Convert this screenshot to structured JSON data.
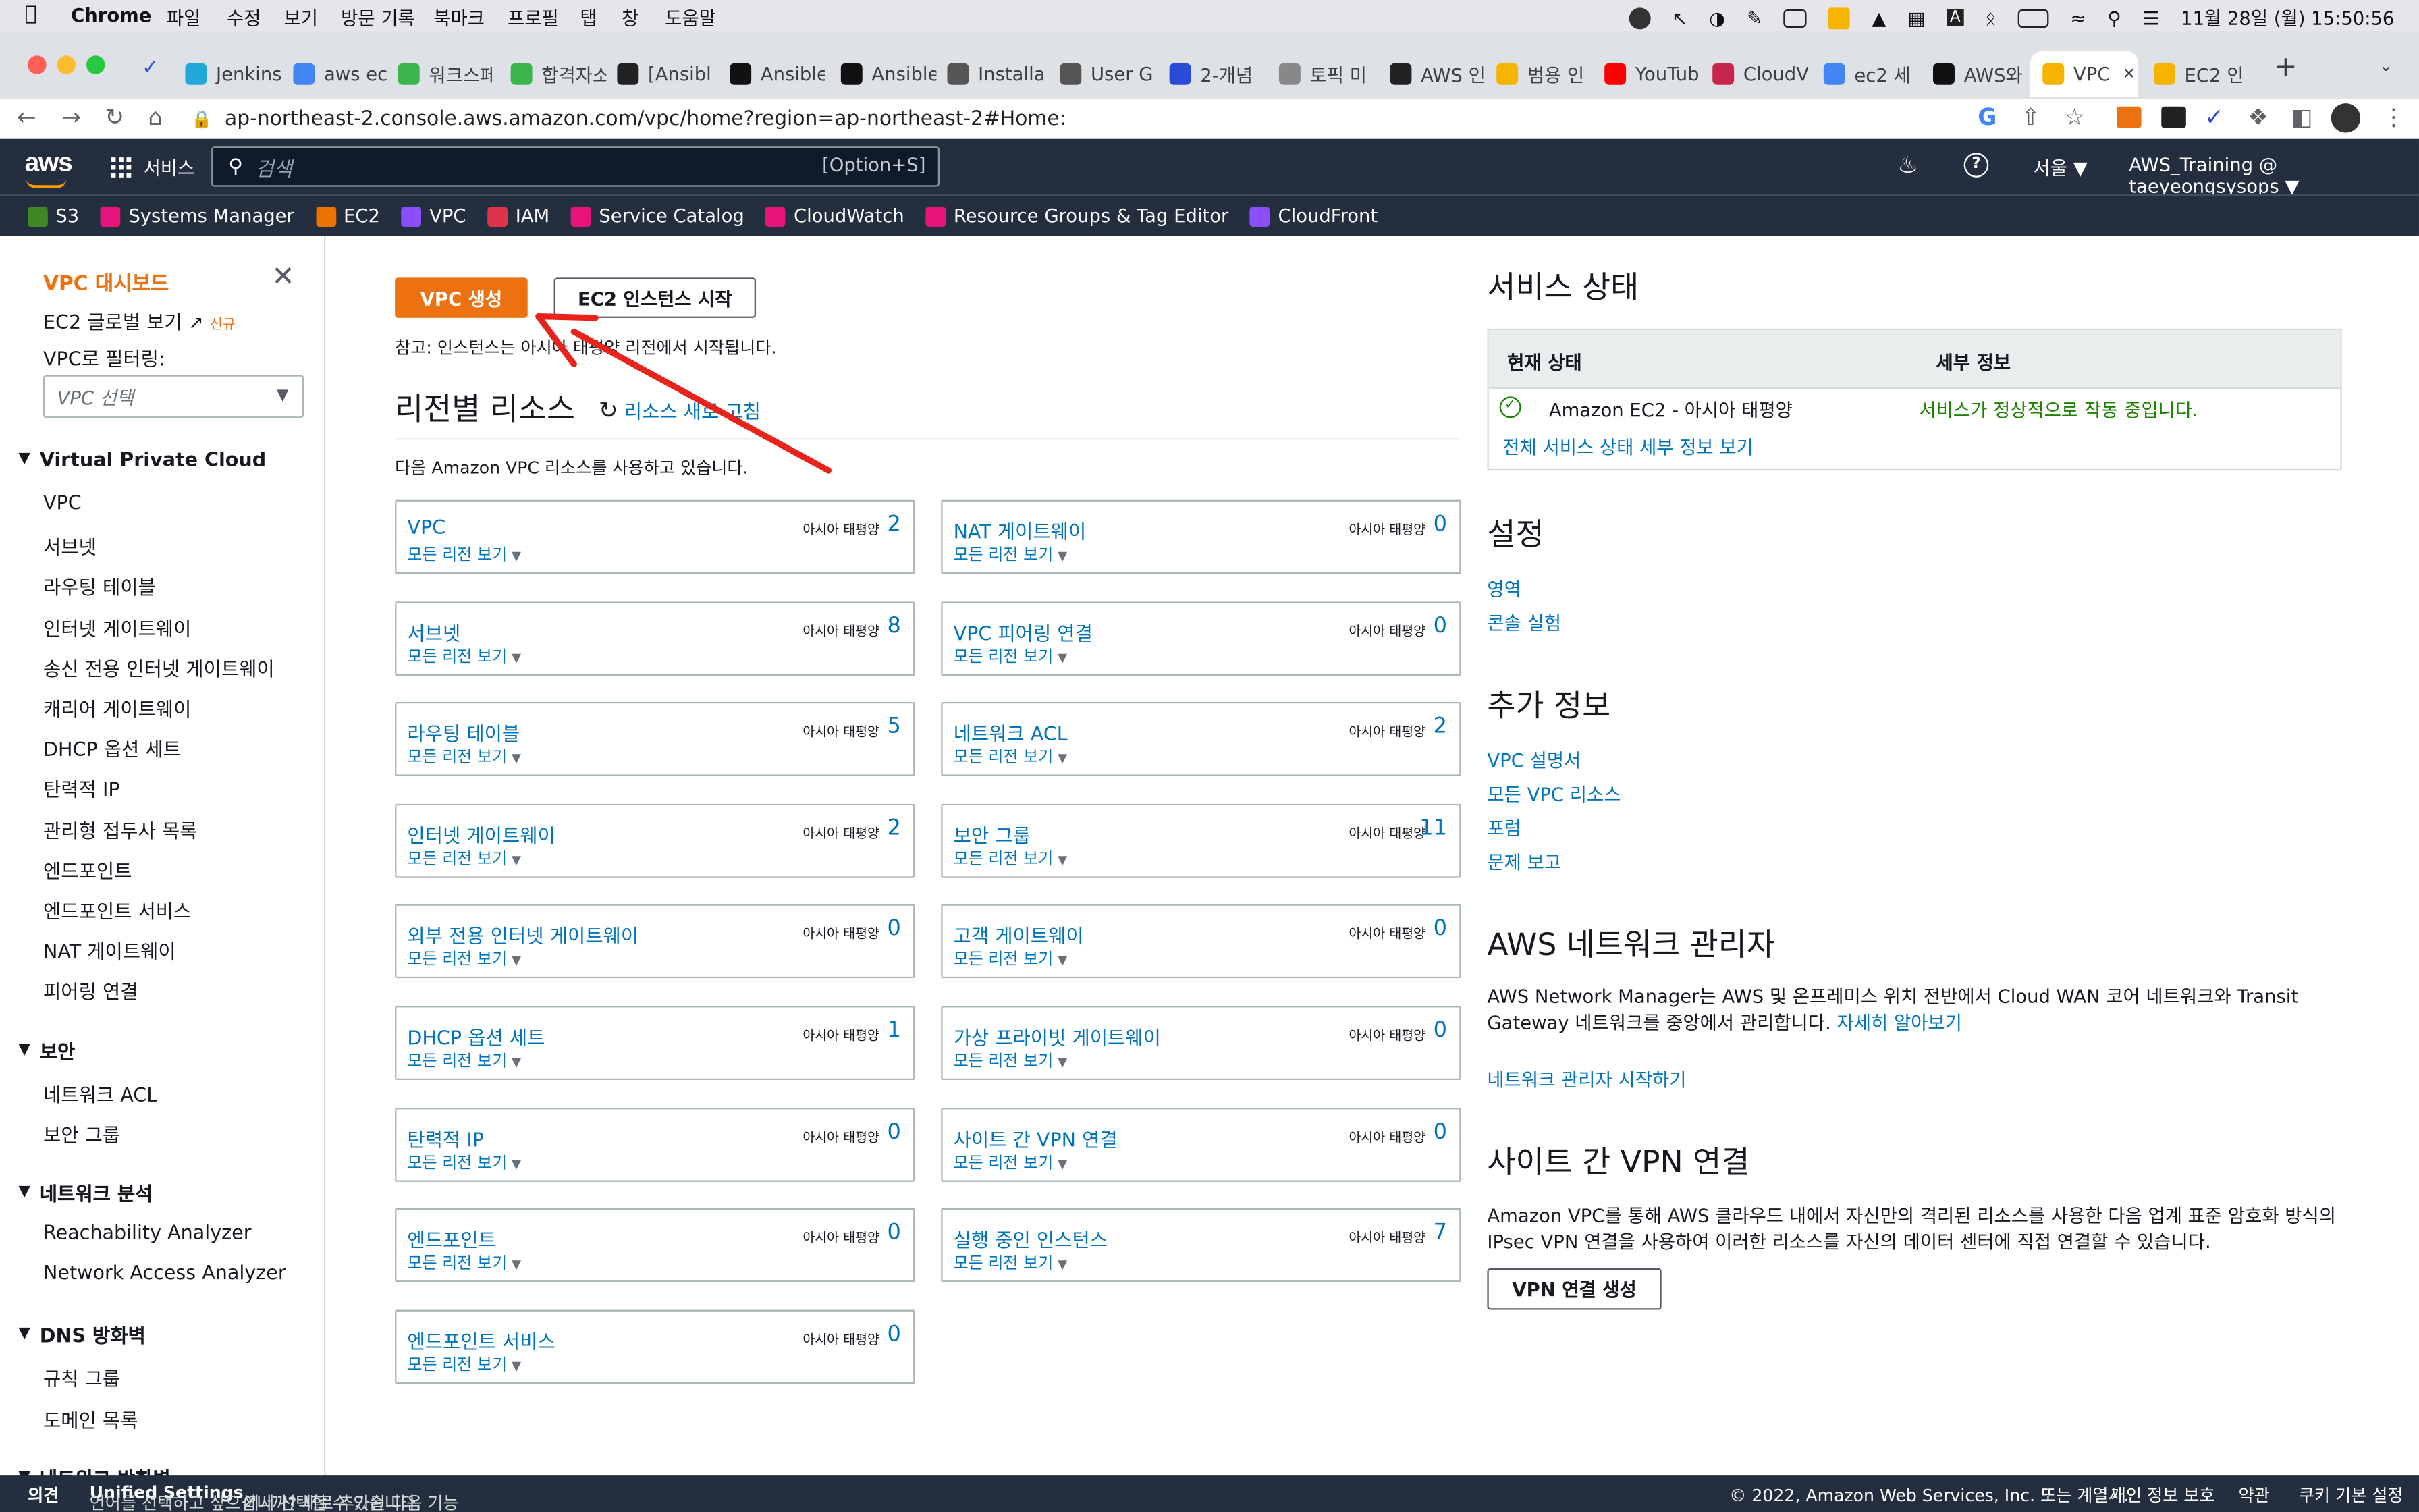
{
  "menubar": {
    "app": "Chrome",
    "items": [
      "파일",
      "수정",
      "보기",
      "방문 기록",
      "북마크",
      "프로필",
      "탭",
      "창",
      "도움말"
    ],
    "datetime": "11월 28일 (월)  15:50:56"
  },
  "tabs": [
    {
      "label": "Jenkins",
      "color": "#20a8d8"
    },
    {
      "label": "aws ec",
      "color": "#4285f4"
    },
    {
      "label": "워크스페",
      "color": "#3ab54a"
    },
    {
      "label": "합격자소",
      "color": "#3ab54a"
    },
    {
      "label": "[Ansibl",
      "color": "#222"
    },
    {
      "label": "Ansible",
      "color": "#111"
    },
    {
      "label": "Ansible",
      "color": "#111"
    },
    {
      "label": "Installa",
      "color": "#555"
    },
    {
      "label": "User G",
      "color": "#555"
    },
    {
      "label": "2-개념",
      "color": "#2a4bd7"
    },
    {
      "label": "토픽 미",
      "color": "#888"
    },
    {
      "label": "AWS 인",
      "color": "#222"
    },
    {
      "label": "범용 인",
      "color": "#f4b400"
    },
    {
      "label": "YouTub",
      "color": "#ff0000"
    },
    {
      "label": "CloudV",
      "color": "#c7254e"
    },
    {
      "label": "ec2 세",
      "color": "#4285f4"
    },
    {
      "label": "AWS와",
      "color": "#111"
    },
    {
      "label": "VPC",
      "color": "#f4b400"
    },
    {
      "label": "EC2 인",
      "color": "#f4b400"
    }
  ],
  "address": {
    "url": "ap-northeast-2.console.aws.amazon.com/vpc/home?region=ap-northeast-2#Home:"
  },
  "header": {
    "services": "서비스",
    "search_placeholder": "검색",
    "shortcut": "[Option+S]",
    "region": "서울 ▼",
    "account": "AWS_Training @ taeyeongsysops ▼"
  },
  "favorites": [
    {
      "label": "S3",
      "color": "#3f8624"
    },
    {
      "label": "Systems Manager",
      "color": "#e7157b"
    },
    {
      "label": "EC2",
      "color": "#ed7100"
    },
    {
      "label": "VPC",
      "color": "#8c4fff"
    },
    {
      "label": "IAM",
      "color": "#dd344c"
    },
    {
      "label": "Service Catalog",
      "color": "#e7157b"
    },
    {
      "label": "CloudWatch",
      "color": "#e7157b"
    },
    {
      "label": "Resource Groups & Tag Editor",
      "color": "#e7157b"
    },
    {
      "label": "CloudFront",
      "color": "#8c4fff"
    }
  ],
  "sidebar": {
    "title": "VPC 대시보드",
    "global_view": "EC2 글로벌 보기",
    "new_badge": "신규",
    "filter_label": "VPC로 필터링:",
    "filter_placeholder": "VPC 선택",
    "sections": [
      {
        "title": "Virtual Private Cloud",
        "items": [
          "VPC",
          "서브넷",
          "라우팅 테이블",
          "인터넷 게이트웨이",
          "송신 전용 인터넷 게이트웨이",
          "캐리어 게이트웨이",
          "DHCP 옵션 세트",
          "탄력적 IP",
          "관리형 접두사 목록",
          "엔드포인트",
          "엔드포인트 서비스",
          "NAT 게이트웨이",
          "피어링 연결"
        ]
      },
      {
        "title": "보안",
        "items": [
          "네트워크 ACL",
          "보안 그룹"
        ]
      },
      {
        "title": "네트워크 분석",
        "items": [
          "Reachability Analyzer",
          "Network Access Analyzer"
        ]
      },
      {
        "title": "DNS 방화벽",
        "items": [
          "규칙 그룹",
          "도메인 목록"
        ]
      },
      {
        "title": "네트워크 방화벽",
        "items": []
      }
    ]
  },
  "main": {
    "create_vpc": "VPC 생성",
    "launch_ec2": "EC2 인스턴스 시작",
    "note": "참고: 인스턴스는 아시아 태평양 리전에서 시작됩니다.",
    "resources_title": "리전별 리소스",
    "refresh": "리소스 새로 고침",
    "using_text": "다음 Amazon VPC 리소스를 사용하고 있습니다.",
    "region_label": "아시아 태평양",
    "all_regions": "모든 리전 보기",
    "left_cards": [
      {
        "name": "VPC",
        "count": "2"
      },
      {
        "name": "서브넷",
        "count": "8"
      },
      {
        "name": "라우팅 테이블",
        "count": "5"
      },
      {
        "name": "인터넷 게이트웨이",
        "count": "2"
      },
      {
        "name": "외부 전용 인터넷 게이트웨이",
        "count": "0"
      },
      {
        "name": "DHCP 옵션 세트",
        "count": "1"
      },
      {
        "name": "탄력적 IP",
        "count": "0"
      },
      {
        "name": "엔드포인트",
        "count": "0"
      },
      {
        "name": "엔드포인트 서비스",
        "count": "0"
      }
    ],
    "right_cards": [
      {
        "name": "NAT 게이트웨이",
        "count": "0"
      },
      {
        "name": "VPC 피어링 연결",
        "count": "0"
      },
      {
        "name": "네트워크 ACL",
        "count": "2"
      },
      {
        "name": "보안 그룹",
        "count": "11"
      },
      {
        "name": "고객 게이트웨이",
        "count": "0"
      },
      {
        "name": "가상 프라이빗 게이트웨이",
        "count": "0"
      },
      {
        "name": "사이트 간 VPN 연결",
        "count": "0"
      },
      {
        "name": "실행 중인 인스턴스",
        "count": "7"
      }
    ]
  },
  "right": {
    "service_health": "서비스 상태",
    "col_current": "현재 상태",
    "col_detail": "세부 정보",
    "service_name": "Amazon EC2 - 아시아 태평양",
    "service_status": "서비스가 정상적으로 작동 중입니다.",
    "all_health_link": "전체 서비스 상태 세부 정보 보기",
    "settings": "설정",
    "settings_links": [
      "영역",
      "콘솔 실험"
    ],
    "additional": "추가 정보",
    "additional_links": [
      "VPC 설명서",
      "모든 VPC 리소스",
      "포럼",
      "문제 보고"
    ],
    "network_manager": "AWS 네트워크 관리자",
    "nm_text": "AWS Network Manager는 AWS 및 온프레미스 위치 전반에서 Cloud WAN 코어 네트워크와 Transit Gateway 네트워크를 중앙에서 관리합니다.",
    "nm_learn": "자세히 알아보기",
    "nm_start": "네트워크 관리자 시작하기",
    "vpn_title": "사이트 간 VPN 연결",
    "vpn_text": "Amazon VPC를 통해 AWS 클라우드 내에서 자신만의 격리된 리소스를 사용한 다음 업계 표준 암호화 방식의 IPsec VPN 연결을 사용하여 이러한 리소스를 자신의 데이터 센터에 직접 연결할 수 있습니다.",
    "vpn_button": "VPN 연결 생성"
  },
  "footer": {
    "feedback": "의견",
    "lang_text_1": "언어를 선택하고 싶으십니까? 새로 추가된 다음 기능",
    "unified": "Unified Settings",
    "lang_text_2": "에서 선택할 수 있습니다.",
    "copyright": "© 2022, Amazon Web Services, Inc. 또는 계열사.",
    "privacy": "개인 정보 보호",
    "terms": "약관",
    "cookies": "쿠키 기본 설정"
  },
  "colors": {
    "aws_dark": "#232f3e",
    "aws_orange": "#ec7211",
    "link": "#0073bb",
    "annotation_arrow": "#e8231c"
  }
}
